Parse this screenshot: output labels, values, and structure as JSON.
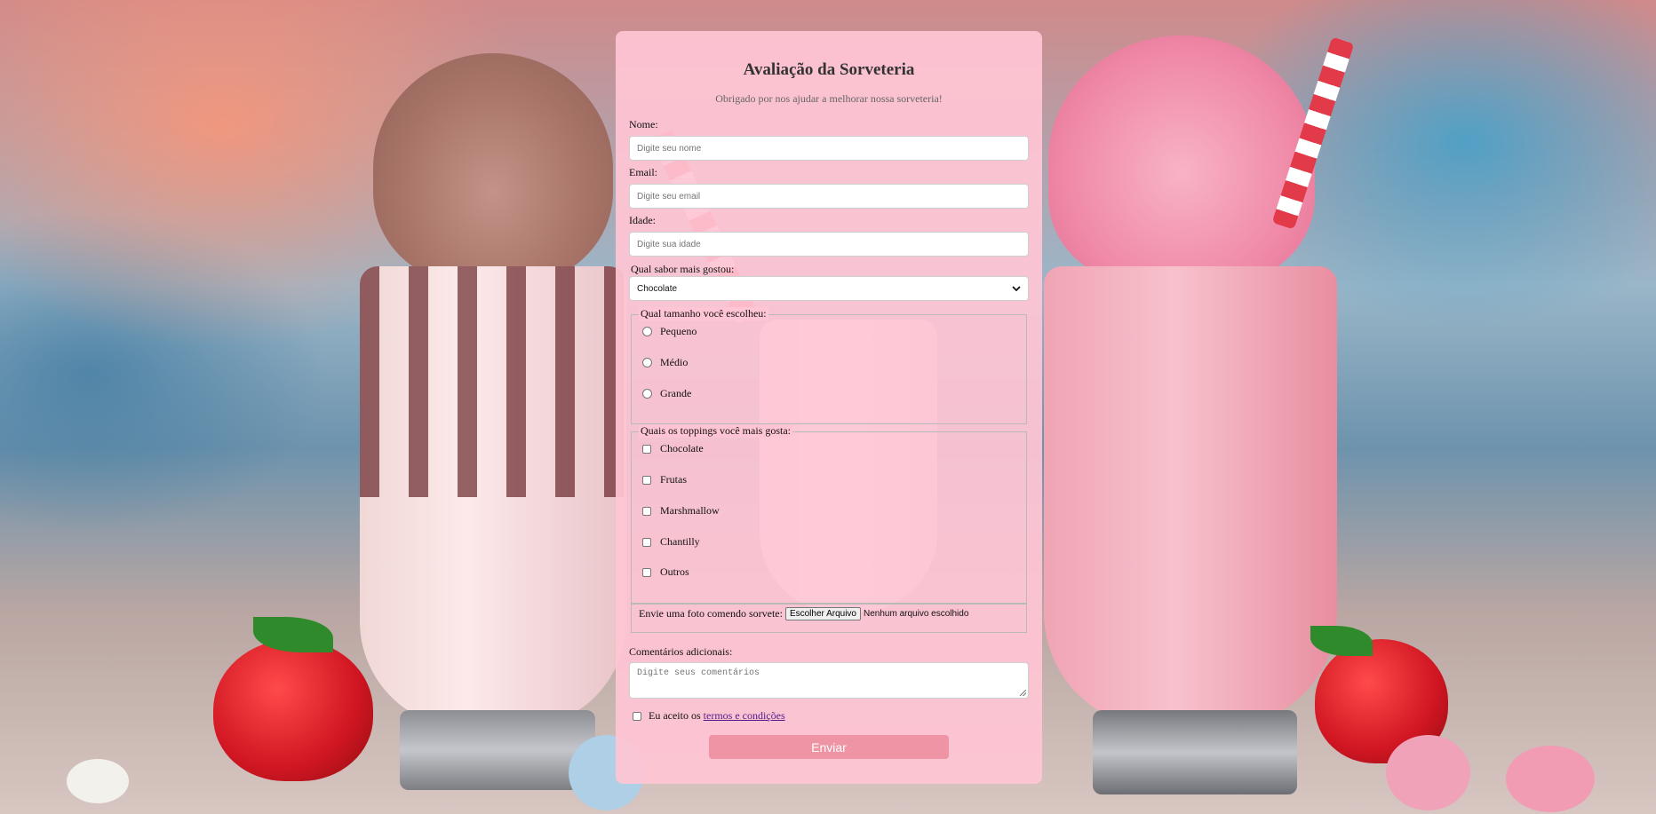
{
  "form": {
    "title": "Avaliação da Sorveteria",
    "subtitle": "Obrigado por nos ajudar a melhorar nossa sorveteria!",
    "name_label": "Nome:",
    "name_placeholder": "Digite seu nome",
    "email_label": "Email:",
    "email_placeholder": "Digite seu email",
    "age_label": "Idade:",
    "age_placeholder": "Digite sua idade",
    "flavor_label": "Qual sabor mais gostou:",
    "flavor_selected": "Chocolate",
    "size_legend": "Qual tamanho você escolheu:",
    "sizes": [
      "Pequeno",
      "Médio",
      "Grande"
    ],
    "toppings_legend": "Quais os toppings você mais gosta:",
    "toppings": [
      "Chocolate",
      "Frutas",
      "Marshmallow",
      "Chantilly",
      "Outros"
    ],
    "upload_label": "Envie uma foto comendo sorvete:",
    "upload_button": "Escolher Arquivo",
    "upload_status": "Nenhum arquivo escolhido",
    "comments_label": "Comentários adicionais:",
    "comments_placeholder": "Digite seus comentários",
    "terms_prefix": "Eu aceito os",
    "terms_link": "termos e condições",
    "submit_label": "Enviar"
  },
  "colors": {
    "card_background": "#ffc5d4",
    "submit_button": "#ee94a4",
    "link": "#551a8b"
  },
  "icons": {
    "select_arrow": "chevron-down-icon",
    "textarea_resize": "resize-handle-icon"
  }
}
